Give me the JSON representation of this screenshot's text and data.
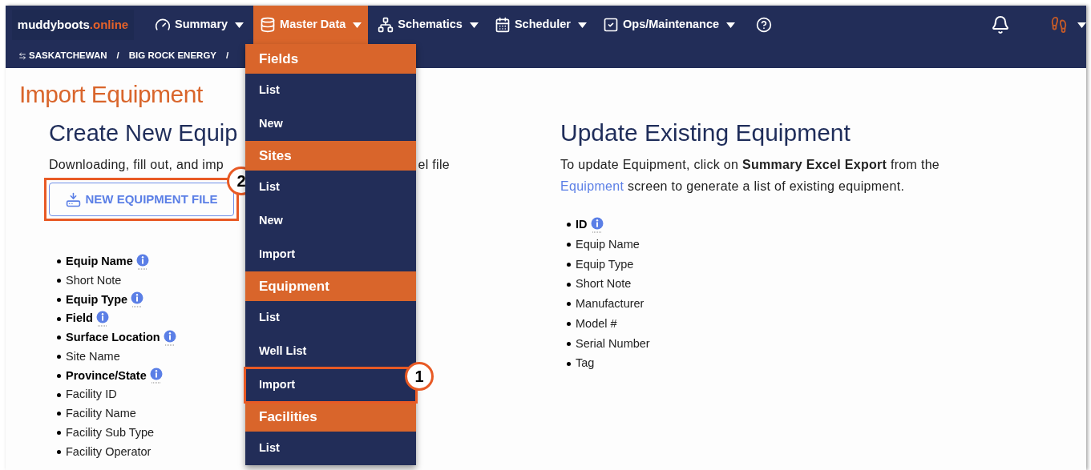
{
  "brand": {
    "name": "muddyboots",
    "suffix": ".online"
  },
  "nav": [
    {
      "label": "Summary",
      "selected": false
    },
    {
      "label": "Master Data",
      "selected": true
    },
    {
      "label": "Schematics",
      "selected": false
    },
    {
      "label": "Scheduler",
      "selected": false
    },
    {
      "label": "Ops/Maintenance",
      "selected": false
    }
  ],
  "breadcrumb": {
    "items": [
      "SASKATCHEWAN",
      "BIG ROCK ENERGY"
    ],
    "separator": "/"
  },
  "page_title": "Import Equipment",
  "create": {
    "heading": "Create New Equip",
    "intro_start": "Downloading, fill out, and imp",
    "intro_end": "el file",
    "button": "NEW EQUIPMENT FILE",
    "callout": "2",
    "fields": [
      {
        "label": "Equip Name",
        "required": true,
        "info": true
      },
      {
        "label": "Short Note",
        "required": false,
        "info": false
      },
      {
        "label": "Equip Type",
        "required": true,
        "info": true
      },
      {
        "label": "Field",
        "required": true,
        "info": true
      },
      {
        "label": "Surface Location",
        "required": true,
        "info": true
      },
      {
        "label": "Site Name",
        "required": false,
        "info": false
      },
      {
        "label": "Province/State",
        "required": true,
        "info": true
      },
      {
        "label": "Facility ID",
        "required": false,
        "info": false
      },
      {
        "label": "Facility Name",
        "required": false,
        "info": false
      },
      {
        "label": "Facility Sub Type",
        "required": false,
        "info": false
      },
      {
        "label": "Facility Operator",
        "required": false,
        "info": false
      }
    ]
  },
  "update": {
    "heading": "Update Existing Equipment",
    "description": "To update Equipment, click on **Summary Excel Export** from the",
    "link": "Equipment",
    "description_end": "screen to generate a list of existing equipment.",
    "fields": [
      {
        "label": "ID",
        "required": true,
        "info": true
      },
      {
        "label": "Equip Name",
        "required": false,
        "info": false
      },
      {
        "label": "Equip Type",
        "required": false,
        "info": false
      },
      {
        "label": "Short Note",
        "required": false,
        "info": false
      },
      {
        "label": "Manufacturer",
        "required": false,
        "info": false
      },
      {
        "label": "Model #",
        "required": false,
        "info": false
      },
      {
        "label": "Serial Number",
        "required": false,
        "info": false
      },
      {
        "label": "Tag",
        "required": false,
        "info": false
      }
    ]
  },
  "menu": {
    "sections": [
      {
        "title": "Fields",
        "items": [
          {
            "label": "List",
            "highlighted": false
          },
          {
            "label": "New",
            "highlighted": false
          }
        ]
      },
      {
        "title": "Sites",
        "items": [
          {
            "label": "List",
            "highlighted": false
          },
          {
            "label": "New",
            "highlighted": false
          },
          {
            "label": "Import",
            "highlighted": false
          }
        ]
      },
      {
        "title": "Equipment",
        "items": [
          {
            "label": "List",
            "highlighted": false
          },
          {
            "label": "Well List",
            "highlighted": false
          },
          {
            "label": "Import",
            "highlighted": true,
            "callout": "1"
          }
        ]
      },
      {
        "title": "Facilities",
        "items": [
          {
            "label": "List",
            "highlighted": false
          }
        ]
      }
    ]
  }
}
